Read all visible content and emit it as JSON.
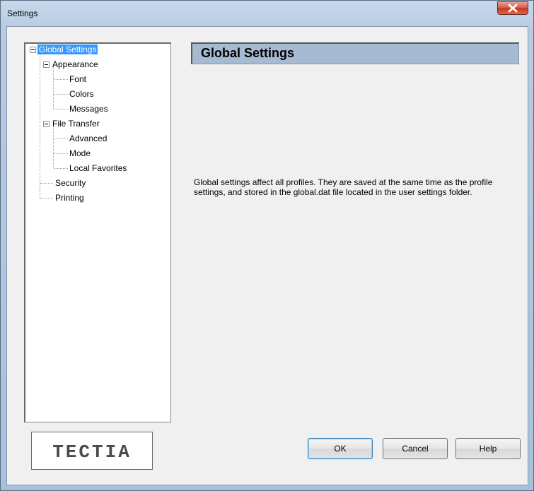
{
  "window": {
    "title": "Settings"
  },
  "tree": {
    "items": [
      {
        "label": "Global Settings",
        "selected": true,
        "expanded": true
      },
      {
        "label": "Appearance",
        "expanded": true
      },
      {
        "label": "Font"
      },
      {
        "label": "Colors"
      },
      {
        "label": "Messages"
      },
      {
        "label": "File Transfer",
        "expanded": true
      },
      {
        "label": "Advanced"
      },
      {
        "label": "Mode"
      },
      {
        "label": "Local Favorites"
      },
      {
        "label": "Security"
      },
      {
        "label": "Printing"
      }
    ]
  },
  "panel": {
    "title": "Global Settings",
    "description": "Global settings affect all profiles. They are saved at the same time as the profile settings, and stored in the global.dat file located in the user settings folder."
  },
  "logo": {
    "text": "TECTIA"
  },
  "buttons": {
    "ok": "OK",
    "cancel": "Cancel",
    "help": "Help"
  },
  "colors": {
    "selection": "#3399ff",
    "header_bar": "#a6bad2",
    "close_button": "#c4371f"
  },
  "icons": {
    "close": "close-icon",
    "expander": "minus-box-icon"
  }
}
